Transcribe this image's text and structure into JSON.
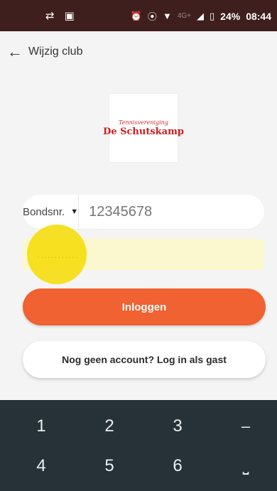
{
  "status_bar": {
    "left_icons": [
      "sync-icon",
      "notification-icon"
    ],
    "right_icons": [
      "alarm-icon",
      "location-icon",
      "wifi-icon",
      "signal-icon",
      "battery-icon"
    ],
    "network": "4G+",
    "battery": "24%",
    "time": "08:44"
  },
  "header": {
    "back_icon": "arrow-left-icon",
    "back_label": "Wijzig club"
  },
  "club_logo": {
    "top_text": "Tennisvereniging",
    "name": "De Schutskamp"
  },
  "login_form": {
    "member_type": "Bondsnr.",
    "member_number_placeholder": "12345678",
    "password_value": "............"
  },
  "buttons": {
    "login": "Inloggen",
    "guest": "Nog geen account? Log in als gast"
  },
  "keyboard": {
    "keys_row1": [
      "1",
      "2",
      "3",
      "–"
    ],
    "keys_row2": [
      "4",
      "5",
      "6",
      "⎵"
    ]
  },
  "colors": {
    "status_bar": "#3f1e1e",
    "accent_orange": "#f06231",
    "password_highlight": "#fbf8cf",
    "keyboard": "#263238"
  }
}
